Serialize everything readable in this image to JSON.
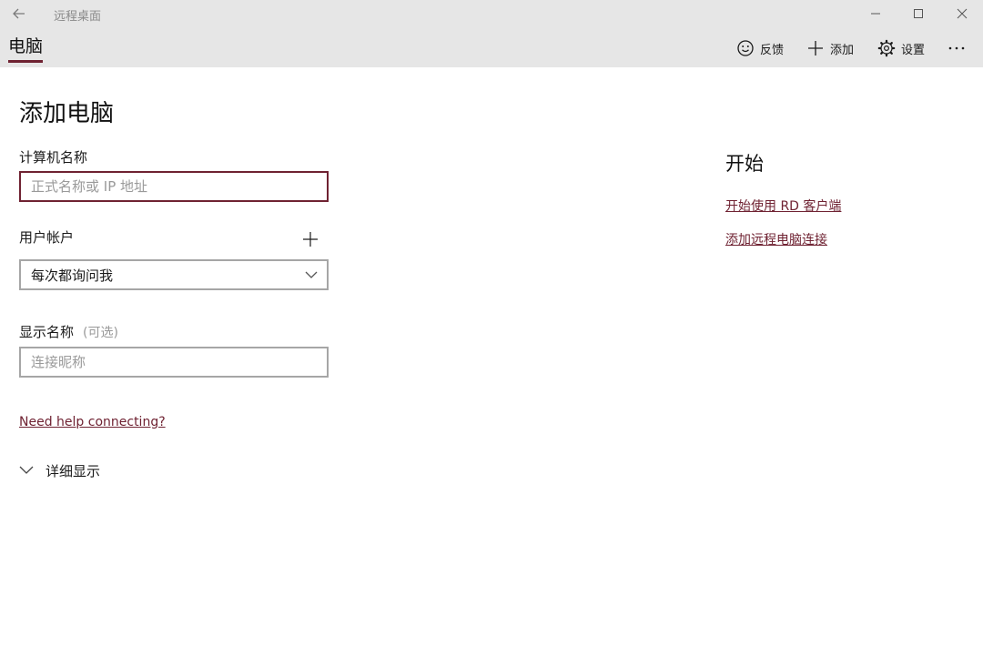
{
  "window": {
    "title": "远程桌面"
  },
  "header": {
    "tab_label": "电脑",
    "commands": {
      "feedback_label": "反馈",
      "add_label": "添加",
      "settings_label": "设置"
    }
  },
  "form": {
    "page_title": "添加电脑",
    "computer_name": {
      "label": "计算机名称",
      "placeholder": "正式名称或 IP 地址",
      "value": ""
    },
    "user_account": {
      "label": "用户帐户",
      "selected": "每次都询问我"
    },
    "display_name": {
      "label": "显示名称",
      "optional_label": "(可选)",
      "placeholder": "连接昵称",
      "value": ""
    },
    "help_link": "Need help connecting?",
    "details_label": "详细显示"
  },
  "side_panel": {
    "title": "开始",
    "links": [
      "开始使用 RD 客户端",
      "添加远程电脑连接"
    ]
  },
  "icons": {
    "back": "back-arrow-icon",
    "minimize": "minimize-icon",
    "maximize": "maximize-icon",
    "close": "close-icon",
    "feedback": "smiley-icon",
    "add": "plus-icon",
    "settings": "gear-icon",
    "more": "more-icon",
    "dropdown": "chevron-down-icon"
  },
  "colors": {
    "accent": "#6f2232",
    "header_bg": "#e6e6e6",
    "border": "#a6a6a6"
  }
}
